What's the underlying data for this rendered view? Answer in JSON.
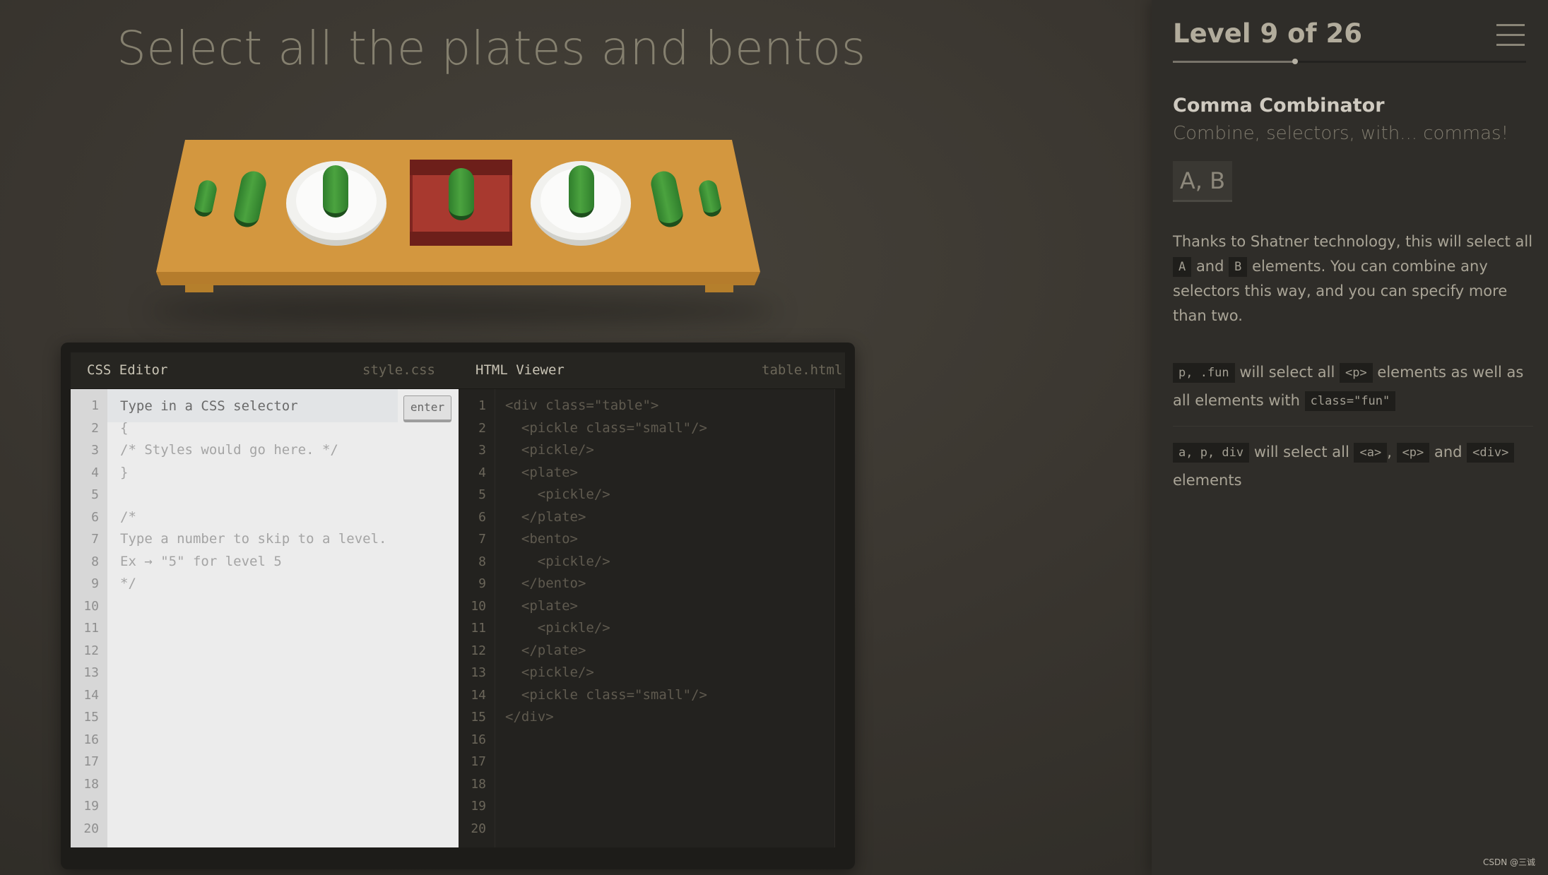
{
  "game": {
    "instruction": "Select all the plates and bentos"
  },
  "editor": {
    "css_title": "CSS Editor",
    "css_file": "style.css",
    "html_title": "HTML Viewer",
    "html_file": "table.html",
    "input_placeholder": "Type in a CSS selector",
    "enter_label": "enter",
    "css_lines": [
      "{",
      "/* Styles would go here. */",
      "}",
      "",
      "/*",
      "Type a number to skip to a level.",
      "Ex → \"5\" for level 5",
      "*/"
    ],
    "html_lines": [
      "<div class=\"table\">",
      "  <pickle class=\"small\"/>",
      "  <pickle/>",
      "  <plate>",
      "    <pickle/>",
      "  </plate>",
      "  <bento>",
      "    <pickle/>",
      "  </bento>",
      "  <plate>",
      "    <pickle/>",
      "  </plate>",
      "  <pickle/>",
      "  <pickle class=\"small\"/>",
      "</div>"
    ],
    "line_count": 20
  },
  "sidebar": {
    "level_header": "Level 9 of 26",
    "progress_fraction": 0.3462,
    "title": "Comma Combinator",
    "subtitle": "Combine, selectors, with... commas!",
    "syntax": "A, B",
    "hint": {
      "p1": "Thanks to Shatner technology, this will select all",
      "tag_a": "A",
      "and_word": "and",
      "tag_b": "B",
      "p2": "elements. You can combine any selectors this way, and you can specify more than two."
    },
    "example1": {
      "code": "p, .fun",
      "t1": "will select all",
      "tag": "<p>",
      "t2": "elements as well as all elements with",
      "code2": "class=\"fun\""
    },
    "example2": {
      "code": "a, p, div",
      "t1": "will select all",
      "tag1": "<a>",
      "comma": ",",
      "tag2": "<p>",
      "and_word": "and",
      "tag3": "<div>",
      "t2": "elements"
    }
  },
  "watermark": "CSDN @三诚",
  "colors": {
    "pickle": "#3f9236",
    "plate": "#f4f4f1",
    "bento": "#8f2a24",
    "table": "#d3973f"
  }
}
